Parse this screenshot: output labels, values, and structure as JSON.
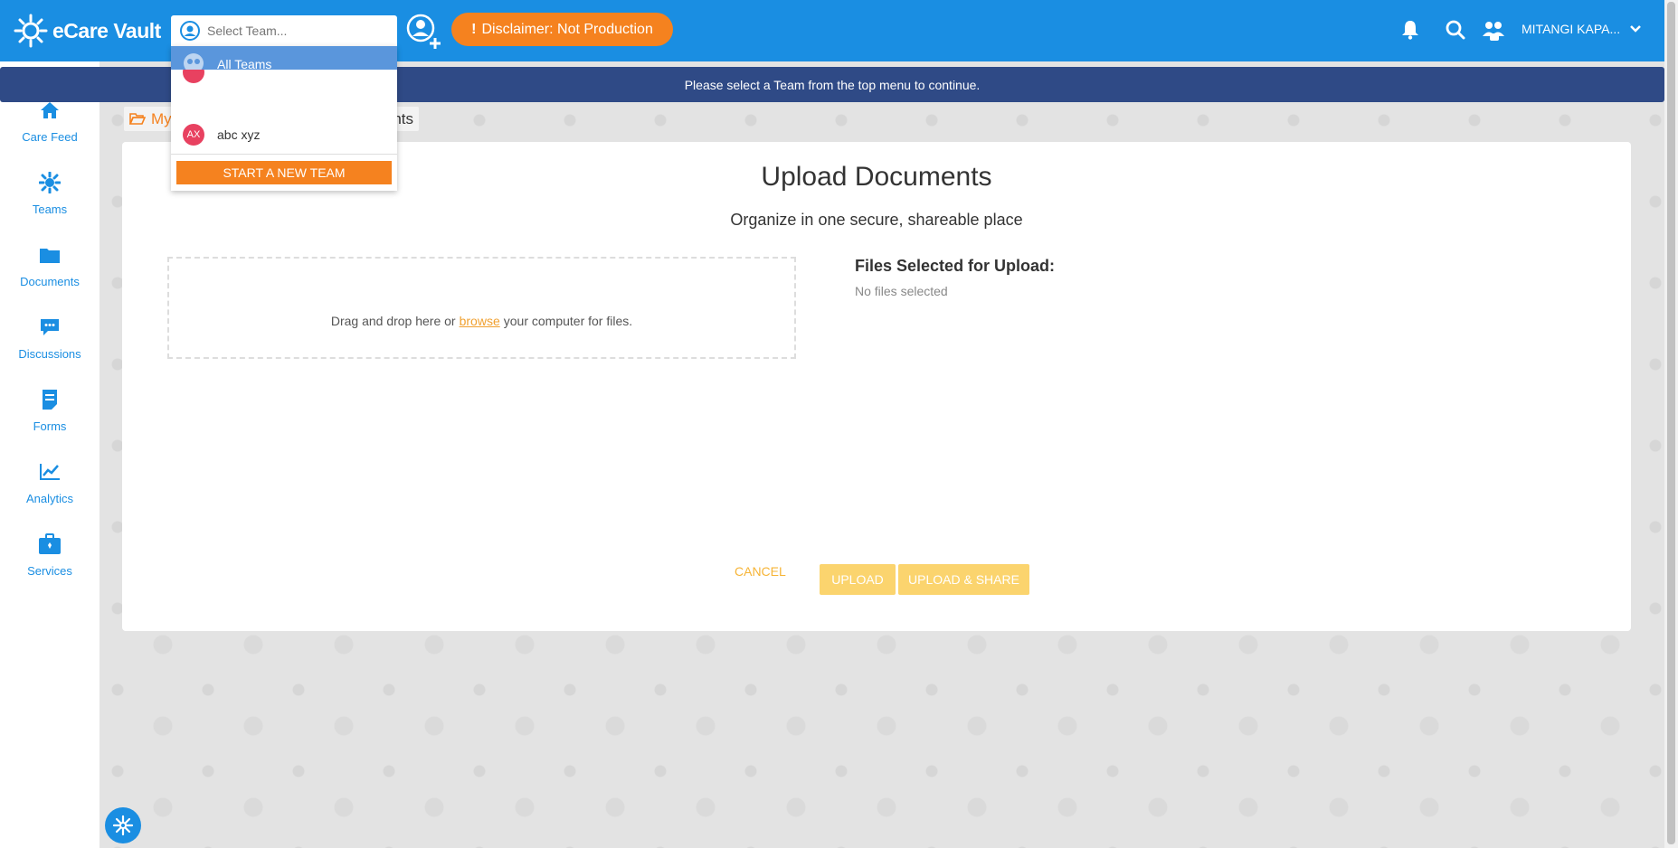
{
  "brand": {
    "logo_text": "eCare Vault"
  },
  "header": {
    "team_select_placeholder": "Select Team...",
    "disclaimer": "Disclaimer: Not Production",
    "user_name": "MITANGI KAPA..."
  },
  "notice": "Please select a Team from the top menu to continue.",
  "team_dropdown": {
    "items": [
      {
        "label": "All Teams"
      },
      {
        "label": "abc xyz",
        "initials": "AX"
      }
    ],
    "start_button": "START A NEW TEAM"
  },
  "sidebar": {
    "items": [
      {
        "label": "Care Feed",
        "icon": "home-icon"
      },
      {
        "label": "Teams",
        "icon": "teams-icon"
      },
      {
        "label": "Documents",
        "icon": "folder-icon"
      },
      {
        "label": "Discussions",
        "icon": "chat-icon"
      },
      {
        "label": "Forms",
        "icon": "form-icon"
      },
      {
        "label": "Analytics",
        "icon": "chart-icon"
      },
      {
        "label": "Services",
        "icon": "briefcase-icon"
      }
    ]
  },
  "breadcrumb": {
    "root": "My",
    "current": "nts"
  },
  "upload": {
    "title": "Upload Documents",
    "subtitle": "Organize in one secure, shareable place",
    "drop_before": "Drag and drop here or",
    "browse": "browse",
    "drop_after": "your computer for files.",
    "files_title": "Files Selected for Upload:",
    "files_empty": "No files selected",
    "cancel": "CANCEL",
    "upload": "UPLOAD",
    "upload_share": "UPLOAD & SHARE"
  },
  "colors": {
    "primary": "#1a8ee2",
    "accent": "#f5821f",
    "notice": "#2f4a86",
    "upload_btn": "#fbd46e"
  }
}
